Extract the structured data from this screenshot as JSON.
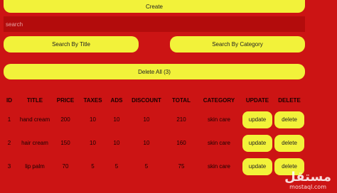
{
  "toolbar": {
    "create_label": "Create",
    "search_placeholder": "search",
    "search_by_title_label": "Search By Title",
    "search_by_category_label": "Search By Category",
    "delete_all_label": "Delete All (3)"
  },
  "table": {
    "headers": [
      "ID",
      "TITLE",
      "PRICE",
      "TAXES",
      "ADS",
      "DISCOUNT",
      "TOTAL",
      "CATEGORY",
      "UPDATE",
      "DELETE"
    ],
    "rows": [
      {
        "id": "1",
        "title": "hand cream",
        "price": "200",
        "taxes": "10",
        "ads": "10",
        "discount": "10",
        "total": "210",
        "category": "skin care",
        "update": "update",
        "delete": "delete"
      },
      {
        "id": "2",
        "title": "hair cream",
        "price": "150",
        "taxes": "10",
        "ads": "10",
        "discount": "10",
        "total": "160",
        "category": "skin care",
        "update": "update",
        "delete": "delete"
      },
      {
        "id": "3",
        "title": "lip palm",
        "price": "70",
        "taxes": "5",
        "ads": "5",
        "discount": "5",
        "total": "75",
        "category": "skin care",
        "update": "update",
        "delete": "delete"
      }
    ]
  },
  "watermark": {
    "arabic": "مستقل",
    "latin": "mostaql.com"
  },
  "colors": {
    "background": "#cc1414",
    "button": "#f2f23a",
    "search_bg": "#b30c0c"
  }
}
